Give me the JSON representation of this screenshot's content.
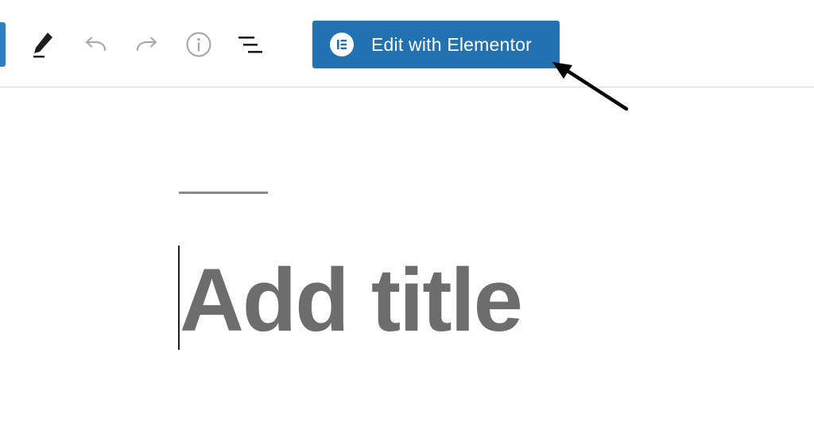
{
  "toolbar": {
    "tools": [
      {
        "name": "pen-icon",
        "state": "active"
      },
      {
        "name": "undo-icon",
        "state": "disabled"
      },
      {
        "name": "redo-icon",
        "state": "disabled"
      },
      {
        "name": "info-icon",
        "state": "disabled"
      },
      {
        "name": "list-view-icon",
        "state": "active"
      }
    ],
    "elementor_button": {
      "label": "Edit with Elementor",
      "icon": "elementor-logo-icon"
    }
  },
  "editor": {
    "title_placeholder": "Add title"
  },
  "colors": {
    "accent": "#2271b1",
    "left_accent": "#2f7fc1",
    "title_placeholder": "#6d6d6d",
    "divider": "#dcdcde"
  }
}
